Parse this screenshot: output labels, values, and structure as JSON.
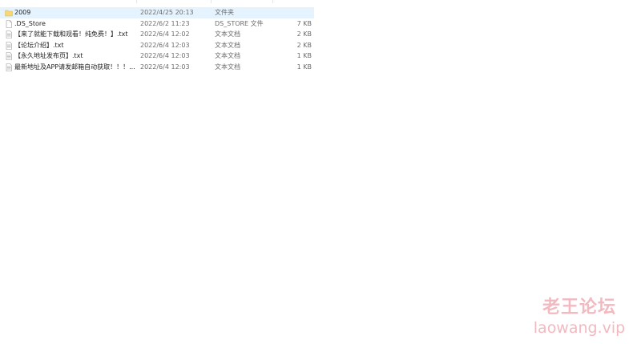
{
  "files": [
    {
      "name": "2009",
      "date": "2022/4/25 20:13",
      "type": "文件夹",
      "size": "",
      "icon": "folder-icon",
      "selected": true
    },
    {
      "name": ".DS_Store",
      "date": "2022/6/2 11:23",
      "type": "DS_STORE 文件",
      "size": "7 KB",
      "icon": "file-icon",
      "selected": false
    },
    {
      "name": "【来了就能下载和观看！纯免费！】.txt",
      "date": "2022/6/4 12:02",
      "type": "文本文档",
      "size": "2 KB",
      "icon": "text-file-icon",
      "selected": false
    },
    {
      "name": "【论坛介绍】.txt",
      "date": "2022/6/4 12:03",
      "type": "文本文档",
      "size": "2 KB",
      "icon": "text-file-icon",
      "selected": false
    },
    {
      "name": "【永久地址发布页】.txt",
      "date": "2022/6/4 12:03",
      "type": "文本文档",
      "size": "1 KB",
      "icon": "text-file-icon",
      "selected": false
    },
    {
      "name": "最新地址及APP请发邮箱自动获取！！！....",
      "date": "2022/6/4 12:03",
      "type": "文本文档",
      "size": "1 KB",
      "icon": "text-file-icon",
      "selected": false
    }
  ],
  "watermark": {
    "line1": "老王论坛",
    "line2": "laowang.vip"
  },
  "colors": {
    "selection": "#e5f3ff",
    "folder": "#f8d775",
    "watermark": "#f3b9c0"
  }
}
